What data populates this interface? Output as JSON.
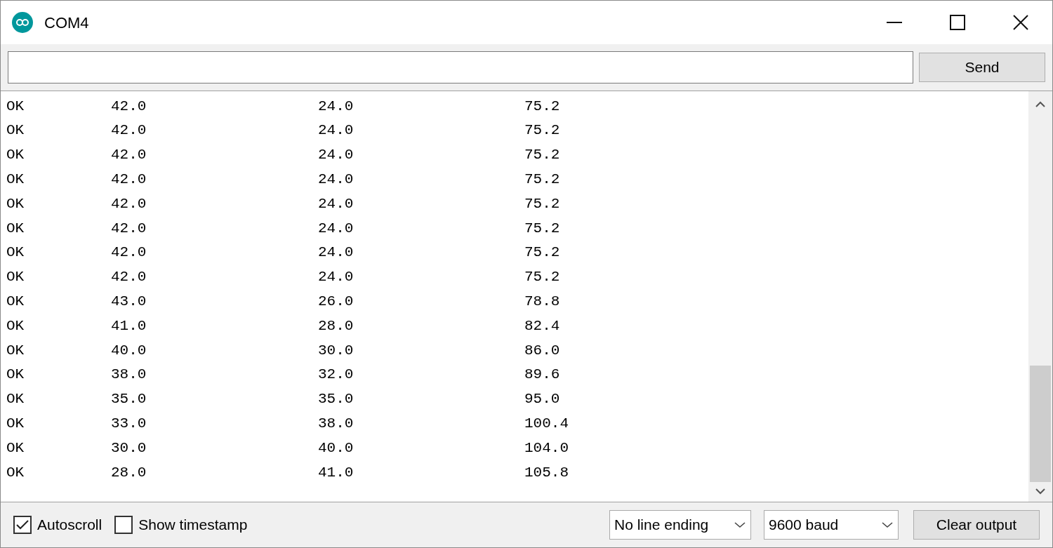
{
  "window": {
    "title": "COM4"
  },
  "input": {
    "send_button": "Send"
  },
  "output": {
    "lines": [
      [
        "OK",
        "42.0",
        "24.0",
        "75.2"
      ],
      [
        "OK",
        "42.0",
        "24.0",
        "75.2"
      ],
      [
        "OK",
        "42.0",
        "24.0",
        "75.2"
      ],
      [
        "OK",
        "42.0",
        "24.0",
        "75.2"
      ],
      [
        "OK",
        "42.0",
        "24.0",
        "75.2"
      ],
      [
        "OK",
        "42.0",
        "24.0",
        "75.2"
      ],
      [
        "OK",
        "42.0",
        "24.0",
        "75.2"
      ],
      [
        "OK",
        "42.0",
        "24.0",
        "75.2"
      ],
      [
        "OK",
        "43.0",
        "26.0",
        "78.8"
      ],
      [
        "OK",
        "41.0",
        "28.0",
        "82.4"
      ],
      [
        "OK",
        "40.0",
        "30.0",
        "86.0"
      ],
      [
        "OK",
        "38.0",
        "32.0",
        "89.6"
      ],
      [
        "OK",
        "35.0",
        "35.0",
        "95.0"
      ],
      [
        "OK",
        "33.0",
        "38.0",
        "100.4"
      ],
      [
        "OK",
        "30.0",
        "40.0",
        "104.0"
      ],
      [
        "OK",
        "28.0",
        "41.0",
        "105.8"
      ]
    ]
  },
  "footer": {
    "checkboxes": [
      {
        "label": "Autoscroll",
        "checked": true
      },
      {
        "label": "Show timestamp",
        "checked": false
      }
    ],
    "line_ending": "No line ending",
    "baud": "9600 baud",
    "clear_button": "Clear output"
  }
}
